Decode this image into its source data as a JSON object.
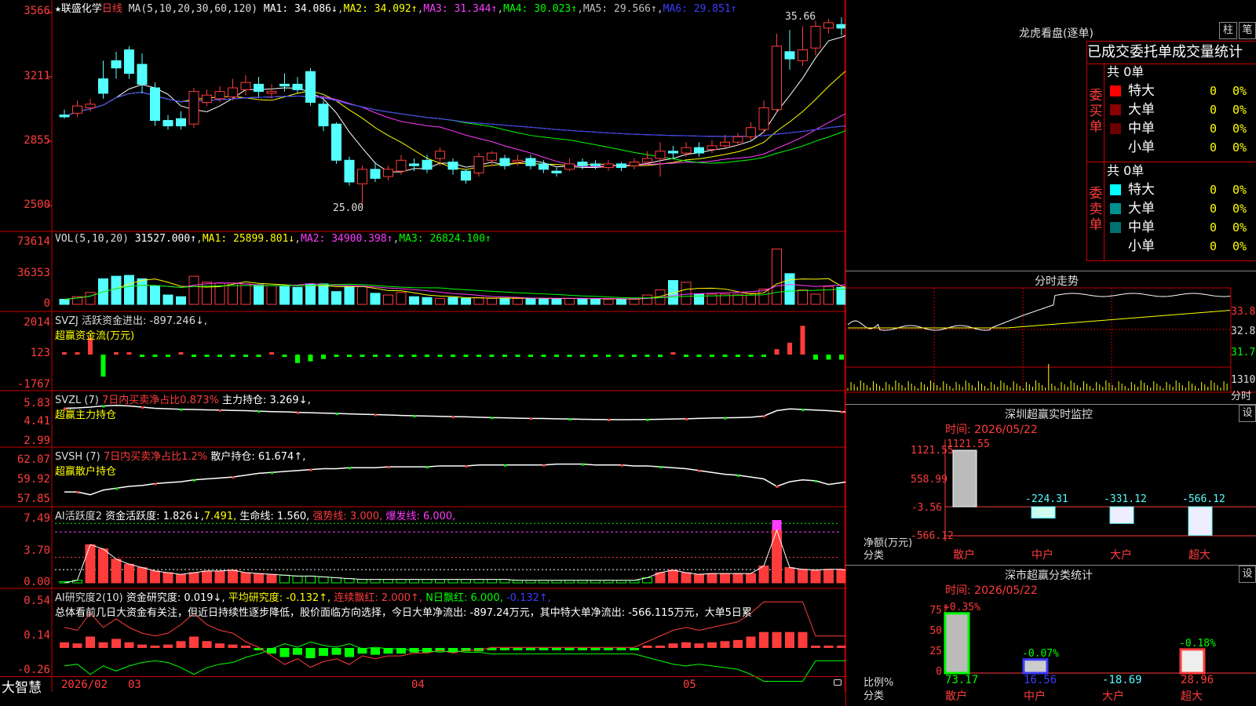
{
  "stock": {
    "star": "★",
    "name": "联盛化学",
    "period": "日线"
  },
  "ma_legend": {
    "label": "MA(5,10,20,30,60,120)",
    "ma1": "MA1: 34.086↓",
    "ma2": "MA2: 34.092↑",
    "ma3": "MA3: 31.344↑",
    "ma4": "MA4: 30.023↑",
    "ma5": "MA5: 29.566↑",
    "ma6": "MA6: 29.851↑"
  },
  "price_axis": [
    "3566",
    "3211",
    "2855",
    "2500"
  ],
  "price_marks": {
    "high": "35.66",
    "low": "25.00"
  },
  "vol_legend": {
    "label": "VOL(5,10,20)",
    "value": "31527.000↑",
    "ma1": "MA1: 25899.801↓",
    "ma2": "MA2: 34900.398↑",
    "ma3": "MA3: 26824.100↑"
  },
  "vol_axis": [
    "73614",
    "36353",
    "0"
  ],
  "svzj": {
    "line1": "SVZJ  活跃资金进出: -897.246↓,",
    "line2": "超赢资金流(万元)",
    "axis": [
      "2014",
      "123",
      "-1767"
    ]
  },
  "svzl": {
    "prefix": "SVZL (7)",
    "ratio": "7日内买卖净占比0.873%",
    "hold": "主力持仓: 3.269↓,",
    "line2": "超赢主力持仓",
    "axis": [
      "5.83",
      "4.41",
      "2.99"
    ]
  },
  "svsh": {
    "prefix": "SVSH (7)",
    "ratio": "7日内买卖净占比1.2%",
    "hold": "散户持仓: 61.674↑,",
    "line2": "超赢散户持仓",
    "axis": [
      "62.07",
      "59.92",
      "57.85"
    ]
  },
  "ai_active": {
    "prefix": "AI活跃度2",
    "a": "资金活跃度: 1.826↓,",
    "b": "7.491,",
    "c": "生命线: 1.560,",
    "d": "强势线: 3.000,",
    "e": "爆发线: 6.000,",
    "axis": [
      "7.49",
      "3.70",
      "0.00"
    ]
  },
  "ai_research": {
    "prefix": "AI研究度2(10)",
    "a": "资金研究度: 0.019↓,",
    "b": "平均研究度: -0.132↑,",
    "c": "连续飘红: 2.000↑,",
    "d": "N日飘红: 6.000,",
    "e": "-0.132↑,",
    "summary": "总体看前几日大资金有关注，但近日持续性逐步降低，股价面临方向选择，今日大单净流出: -897.24万元，其中特大单净流出: -566.115万元，大单5日累",
    "axis": [
      "0.54",
      "0.14",
      "-0.26"
    ]
  },
  "bottom_bar": {
    "brand": "大智慧",
    "date": "2026/02",
    "m3": "03",
    "m4": "04",
    "m5": "05"
  },
  "lhb": {
    "title": "龙虎看盘(逐单)",
    "btn_bar": "柱",
    "btn_bi": "笔",
    "tabs": [
      "已成交",
      "委托单",
      "成交量统计"
    ],
    "buy": {
      "label": [
        "委",
        "买",
        "单"
      ],
      "total": "共 0单",
      "rows": [
        {
          "name": "特大",
          "count": "0",
          "pct": "0%",
          "color": "#ff0000"
        },
        {
          "name": "大单",
          "count": "0",
          "pct": "0%",
          "color": "#8b0000"
        },
        {
          "name": "中单",
          "count": "0",
          "pct": "0%",
          "color": "#6b0000"
        },
        {
          "name": "小单",
          "count": "0",
          "pct": "0%",
          "color": ""
        }
      ]
    },
    "sell": {
      "label": [
        "委",
        "卖",
        "单"
      ],
      "total": "共 0单",
      "rows": [
        {
          "name": "特大",
          "count": "0",
          "pct": "0%",
          "color": "#00ffff"
        },
        {
          "name": "大单",
          "count": "0",
          "pct": "0%",
          "color": "#009090"
        },
        {
          "name": "中单",
          "count": "0",
          "pct": "0%",
          "color": "#007070"
        },
        {
          "name": "小单",
          "count": "0",
          "pct": "0%",
          "color": ""
        }
      ]
    }
  },
  "fenshi": {
    "title": "分时走势",
    "axis": [
      "33.8",
      "32.8",
      "31.7"
    ],
    "vol_value": "1310",
    "vol_label": "分时"
  },
  "monitor": {
    "title": "深圳超赢实时监控",
    "btn": "设",
    "time": "时间: 2026/05/22",
    "axis": [
      "1121.55",
      "558.99",
      "-3.56",
      "-566.12"
    ],
    "side_label1": "净额(万元)",
    "side_label2": "分类",
    "bars": [
      {
        "cat": "散户",
        "value": "1121.55",
        "num": 1121.55
      },
      {
        "cat": "中户",
        "value": "-224.31",
        "num": -224.31
      },
      {
        "cat": "大户",
        "value": "-331.12",
        "num": -331.12
      },
      {
        "cat": "超大",
        "value": "-566.12",
        "num": -566.12
      }
    ]
  },
  "classify": {
    "title": "深市超赢分类统计",
    "btn": "设",
    "time": "时间: 2026/05/22",
    "axis": [
      "75",
      "50",
      "25",
      "0"
    ],
    "side_label1": "比例%",
    "side_label2": "分类",
    "bars": [
      {
        "cat": "散户",
        "top": "+0.35%",
        "value": "73.17",
        "num": 73.17
      },
      {
        "cat": "中户",
        "top": "-0.07%",
        "value": "16.56",
        "num": 16.56
      },
      {
        "cat": "大户",
        "top": "",
        "value": "-18.69",
        "num": -18.69
      },
      {
        "cat": "超大",
        "top": "-0.18%",
        "value": "28.96",
        "num": 28.96
      }
    ]
  },
  "chart_data": {
    "type": "candlestick",
    "ylim": [
      25.0,
      35.66
    ],
    "candles": [
      [
        30.0,
        29.9,
        30.3,
        29.8
      ],
      [
        30.1,
        30.5,
        30.8,
        29.9
      ],
      [
        30.4,
        30.6,
        30.9,
        30.2
      ],
      [
        32.0,
        31.2,
        33.0,
        30.9
      ],
      [
        33.0,
        32.6,
        33.5,
        32.0
      ],
      [
        33.6,
        32.3,
        33.8,
        32.0
      ],
      [
        32.8,
        31.7,
        33.4,
        31.2
      ],
      [
        31.5,
        29.7,
        31.8,
        29.4
      ],
      [
        29.7,
        29.4,
        30.0,
        29.2
      ],
      [
        29.8,
        29.4,
        30.2,
        29.2
      ],
      [
        29.5,
        31.3,
        31.5,
        29.3
      ],
      [
        30.7,
        31.1,
        31.4,
        30.5
      ],
      [
        30.9,
        31.3,
        31.6,
        30.7
      ],
      [
        31.0,
        31.5,
        32.0,
        30.8
      ],
      [
        31.4,
        31.8,
        32.2,
        31.1
      ],
      [
        31.7,
        31.3,
        32.1,
        31.0
      ],
      [
        31.2,
        31.3,
        31.7,
        30.9
      ],
      [
        31.7,
        31.6,
        32.3,
        31.3
      ],
      [
        31.7,
        31.4,
        32.1,
        31.2
      ],
      [
        32.4,
        30.7,
        32.6,
        30.5
      ],
      [
        30.6,
        29.4,
        30.8,
        29.1
      ],
      [
        29.5,
        27.5,
        29.6,
        27.3
      ],
      [
        27.5,
        26.3,
        27.7,
        26.1
      ],
      [
        26.2,
        27.0,
        27.2,
        25.0
      ],
      [
        27.0,
        26.5,
        27.4,
        26.3
      ],
      [
        26.6,
        27.0,
        27.2,
        26.4
      ],
      [
        26.9,
        27.5,
        27.8,
        26.7
      ],
      [
        27.3,
        27.2,
        27.6,
        26.9
      ],
      [
        27.5,
        27.0,
        27.8,
        26.8
      ],
      [
        27.6,
        28.0,
        28.2,
        27.2
      ],
      [
        27.4,
        27.0,
        27.6,
        26.7
      ],
      [
        26.9,
        26.4,
        27.0,
        26.2
      ],
      [
        26.8,
        27.7,
        27.9,
        26.6
      ],
      [
        27.5,
        27.9,
        28.0,
        27.2
      ],
      [
        27.6,
        27.2,
        27.8,
        27.0
      ],
      [
        27.4,
        27.5,
        27.8,
        27.2
      ],
      [
        27.6,
        27.2,
        27.8,
        27.0
      ],
      [
        27.3,
        27.0,
        27.5,
        26.8
      ],
      [
        26.9,
        26.8,
        27.1,
        26.6
      ],
      [
        27.0,
        27.3,
        27.6,
        26.9
      ],
      [
        27.4,
        27.2,
        27.6,
        27.0
      ],
      [
        27.3,
        27.2,
        27.5,
        27.0
      ],
      [
        27.1,
        27.3,
        27.5,
        26.9
      ],
      [
        27.3,
        27.1,
        27.4,
        26.9
      ],
      [
        27.2,
        27.4,
        27.6,
        27.0
      ],
      [
        27.4,
        27.6,
        28.0,
        27.2
      ],
      [
        27.6,
        28.0,
        28.5,
        26.6
      ],
      [
        28.0,
        27.9,
        28.3,
        27.6
      ],
      [
        27.9,
        28.2,
        28.5,
        27.7
      ],
      [
        28.2,
        27.9,
        28.5,
        27.7
      ],
      [
        28.1,
        28.3,
        28.6,
        27.9
      ],
      [
        28.3,
        28.5,
        28.9,
        28.1
      ],
      [
        28.5,
        28.8,
        29.0,
        28.3
      ],
      [
        28.8,
        29.3,
        29.6,
        28.6
      ],
      [
        29.2,
        30.4,
        30.8,
        29.0
      ],
      [
        30.3,
        33.8,
        34.5,
        30.1
      ],
      [
        33.5,
        33.1,
        34.7,
        32.5
      ],
      [
        33.0,
        33.6,
        34.9,
        32.7
      ],
      [
        33.7,
        34.9,
        35.2,
        33.3
      ],
      [
        34.8,
        35.1,
        35.3,
        34.5
      ],
      [
        35.0,
        34.8,
        35.4,
        34.4
      ],
      [
        34.9,
        34.6,
        35.5,
        34.3
      ],
      [
        34.6,
        34.1,
        35.0,
        33.7
      ],
      [
        34.2,
        33.3,
        35.2,
        33.0
      ],
      [
        33.3,
        34.4,
        35.1,
        33.1
      ]
    ],
    "volumes": [
      6000,
      9000,
      14000,
      30000,
      33000,
      34000,
      30000,
      22000,
      11000,
      9000,
      33000,
      26000,
      25000,
      25000,
      24000,
      23000,
      22000,
      21000,
      20000,
      24000,
      24000,
      15000,
      21000,
      21000,
      13000,
      11000,
      14000,
      9000,
      8000,
      7000,
      8000,
      7000,
      8000,
      7000,
      7000,
      7000,
      7000,
      7000,
      6500,
      7000,
      7000,
      6000,
      6000,
      6000,
      6000,
      11000,
      17000,
      28000,
      26000,
      12000,
      12000,
      12000,
      12000,
      13000,
      18000,
      65000,
      36000,
      17000,
      12000,
      21000,
      20000,
      20000,
      22000,
      23000,
      28000
    ],
    "flow": [
      90,
      90,
      1000,
      -1300,
      70,
      70,
      -90,
      -90,
      -80,
      80,
      -90,
      -90,
      -90,
      -90,
      -90,
      -50,
      100,
      -120,
      -500,
      -400,
      -260,
      -90,
      -70,
      -90,
      -80,
      -60,
      -50,
      -60,
      -50,
      -50,
      -60,
      -50,
      -60,
      -50,
      -60,
      -40,
      -50,
      -60,
      -60,
      -50,
      -60,
      -50,
      -50,
      -60,
      -50,
      -50,
      -40,
      120,
      -30,
      -60,
      -80,
      -90,
      -90,
      -80,
      -60,
      320,
      700,
      1700,
      -300,
      -300,
      -300,
      -400,
      -330,
      -300,
      -700
    ],
    "mainhold": [
      5.4,
      5.43,
      5.5,
      5.6,
      5.65,
      5.6,
      5.5,
      5.4,
      5.36,
      5.32,
      5.3,
      5.27,
      5.25,
      5.22,
      5.2,
      5.16,
      5.12,
      5.1,
      5.06,
      5.03,
      5.0,
      4.97,
      4.93,
      4.9,
      4.87,
      4.84,
      4.8,
      4.77,
      4.75,
      4.72,
      4.7,
      4.68,
      4.65,
      4.62,
      4.6,
      4.57,
      4.55,
      4.54,
      4.52,
      4.5,
      4.48,
      4.46,
      4.45,
      4.44,
      4.45,
      4.46,
      4.48,
      4.5,
      4.52,
      4.55,
      4.58,
      4.6,
      4.62,
      4.65,
      4.75,
      5.2,
      5.35,
      5.3,
      5.25,
      5.2,
      5.12,
      5.05,
      4.95,
      4.6,
      4.3
    ],
    "retailhold": [
      58.6,
      58.6,
      58.3,
      58.8,
      59.0,
      59.2,
      59.3,
      59.5,
      59.6,
      59.7,
      59.9,
      60.0,
      60.1,
      60.2,
      60.4,
      60.6,
      60.7,
      60.8,
      60.9,
      61.0,
      61.1,
      61.1,
      61.2,
      61.2,
      61.2,
      61.3,
      61.3,
      61.3,
      61.3,
      61.4,
      61.4,
      61.4,
      61.5,
      61.5,
      61.5,
      61.5,
      61.5,
      61.5,
      61.6,
      61.6,
      61.6,
      61.5,
      61.5,
      61.5,
      61.4,
      61.4,
      61.3,
      61.2,
      61.1,
      60.9,
      60.7,
      60.5,
      60.4,
      60.2,
      60.0,
      59.2,
      59.7,
      59.9,
      59.8,
      59.4,
      59.6,
      59.8,
      60.2,
      61.2,
      61.0
    ],
    "activity": [
      0,
      0.3,
      4.5,
      4.0,
      2.8,
      2.2,
      1.8,
      1.4,
      1.2,
      1.0,
      1.2,
      1.4,
      1.4,
      1.5,
      1.2,
      1.1,
      1.0,
      0.9,
      0.8,
      0.8,
      0.7,
      0.6,
      0.5,
      0.4,
      0.4,
      0.4,
      0.4,
      0.4,
      0.4,
      0.4,
      0.4,
      0.4,
      0.4,
      0.4,
      0.4,
      0.3,
      0.3,
      0.3,
      0.3,
      0.3,
      0.3,
      0.3,
      0.3,
      0.3,
      0.3,
      0.6,
      1.2,
      1.5,
      1.2,
      1.0,
      1.1,
      1.1,
      1.1,
      1.1,
      2.0,
      6.2,
      1.8,
      1.6,
      1.5,
      1.6,
      1.6,
      1.2,
      1.0,
      1.8,
      1.8
    ],
    "research": [
      0.05,
      0.04,
      0.1,
      0.05,
      0.08,
      0.05,
      0.03,
      0.02,
      0.03,
      0.06,
      0.1,
      0.06,
      0.04,
      0.03,
      0.0,
      -0.02,
      -0.05,
      -0.08,
      -0.06,
      -0.09,
      -0.07,
      -0.06,
      -0.08,
      -0.05,
      -0.06,
      -0.05,
      -0.05,
      -0.04,
      -0.04,
      -0.03,
      -0.04,
      -0.03,
      -0.03,
      -0.02,
      -0.02,
      -0.02,
      -0.02,
      -0.02,
      -0.02,
      -0.02,
      -0.02,
      -0.02,
      -0.02,
      -0.02,
      -0.02,
      0.0,
      0.02,
      0.04,
      0.05,
      0.04,
      0.05,
      0.06,
      0.07,
      0.1,
      0.14,
      0.14,
      0.14,
      0.14,
      0.02,
      0.02,
      0.02,
      0.02,
      0.0,
      -0.03,
      -0.03
    ]
  }
}
